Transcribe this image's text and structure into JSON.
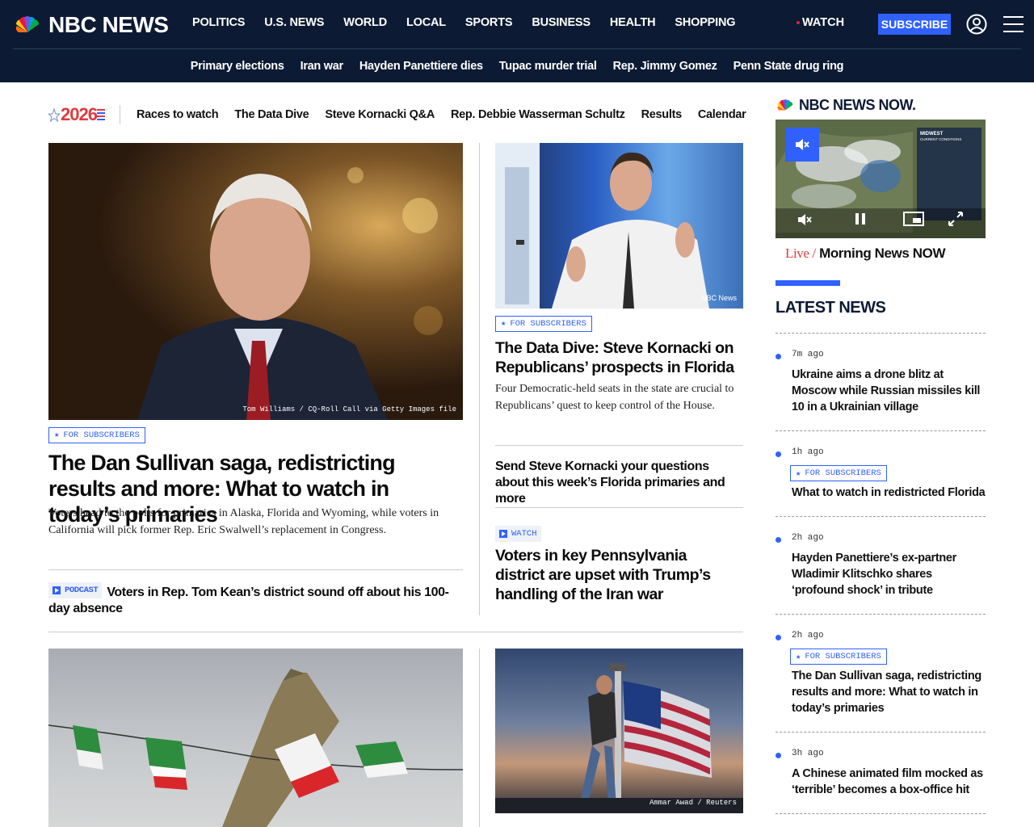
{
  "header": {
    "logo_text": "NBC NEWS",
    "nav": [
      "POLITICS",
      "U.S. NEWS",
      "WORLD",
      "LOCAL",
      "SPORTS",
      "BUSINESS",
      "HEALTH",
      "SHOPPING"
    ],
    "watch_label": "WATCH",
    "subscribe_label": "SUBSCRIBE",
    "trending": [
      "Primary elections",
      "Iran war",
      "Hayden Panettiere dies",
      "Tupac murder trial",
      "Rep. Jimmy Gomez",
      "Penn State drug ring"
    ]
  },
  "subnav": {
    "logo_year": "2026",
    "items": [
      "Races to watch",
      "The Data Dive",
      "Steve Kornacki Q&A",
      "Rep. Debbie Wasserman Schultz",
      "Results",
      "Calendar"
    ]
  },
  "lead": {
    "credit": "Tom Williams / CQ-Roll Call via Getty Images file",
    "tag": "FOR SUBSCRIBERS",
    "headline": "The Dan Sullivan saga, redistricting results and more: What to watch in today’s primaries",
    "dek": "Voters head to the polls for primaries in Alaska, Florida and Wyoming, while voters in California will pick former Rep. Eric Swalwell’s replacement in Congress.",
    "related_tag": "PODCAST",
    "related_headline": "Voters in Rep. Tom Kean’s district sound off about his 100-day absence"
  },
  "second": {
    "credit": "NBC News",
    "tag": "FOR SUBSCRIBERS",
    "headline": "The Data Dive: Steve Kornacki on Republicans’ prospects in Florida",
    "dek": "Four Democratic-held seats in the state are crucial to Republicans’ quest to keep control of the House.",
    "related1": "Send Steve Kornacki your questions about this week’s Florida primaries and more",
    "watch_tag": "WATCH",
    "related2": "Voters in key Pennsylvania district are upset with Trump’s handling of the Iran war"
  },
  "bottom": {
    "right_credit": "Ammar Awad / Reuters"
  },
  "now": {
    "logo_text": "NBC NEWS NOW.",
    "live_label": "Live /",
    "show_title": "Morning News NOW",
    "weather_region": "MIDWEST",
    "weather_sub": "CURRENT CONDITIONS"
  },
  "latest": {
    "heading": "LATEST NEWS",
    "items": [
      {
        "time": "7m ago",
        "tag": "",
        "title": "Ukraine aims a drone blitz at Moscow while Russian missiles kill 10 in a Ukrainian village"
      },
      {
        "time": "1h ago",
        "tag": "FOR SUBSCRIBERS",
        "title": "What to watch in redistricted Florida"
      },
      {
        "time": "2h ago",
        "tag": "",
        "title": "Hayden Panettiere’s ex-partner Wladimir Klitschko shares ‘profound shock’ in tribute"
      },
      {
        "time": "2h ago",
        "tag": "FOR SUBSCRIBERS",
        "title": "The Dan Sullivan saga, redistricting results and more: What to watch in today’s primaries"
      },
      {
        "time": "3h ago",
        "tag": "",
        "title": "A Chinese animated film mocked as ‘terrible’ becomes a box-office hit"
      }
    ]
  }
}
